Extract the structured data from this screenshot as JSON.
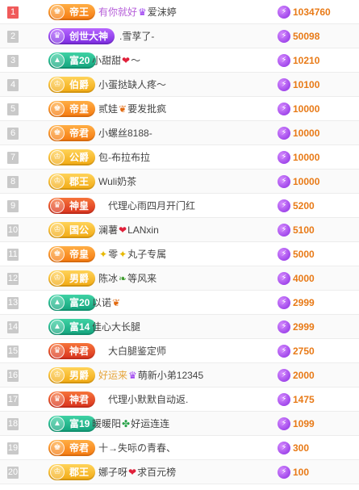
{
  "colors": {
    "score": "#e87a17",
    "rank_top": "#f05a5a",
    "rank_default": "#c9c9c9"
  },
  "rows": [
    {
      "rank": "1",
      "badge": "帝王",
      "badge_color": "orange",
      "name": "有你就好",
      "deco": "crown-icon",
      "name_after": "爱沫婷",
      "name_color": "#b65fd9",
      "score": "1034760"
    },
    {
      "rank": "2",
      "badge": "创世大神",
      "badge_color": "purple",
      "name": ".雪莩了-",
      "deco": "",
      "name_after": "",
      "name_color": "",
      "score": "50098"
    },
    {
      "rank": "3",
      "badge": "富20",
      "badge_color": "green",
      "name": "小甜甜",
      "deco": "heart-icon",
      "name_after": "～",
      "name_color": "",
      "score": "10210"
    },
    {
      "rank": "4",
      "badge": "伯爵",
      "badge_color": "gold",
      "name": "小蛋挞缺人疼～",
      "deco": "",
      "name_after": "",
      "name_color": "",
      "score": "10100"
    },
    {
      "rank": "5",
      "badge": "帝皇",
      "badge_color": "orange",
      "name": "贰娃",
      "deco": "butterfly-icon",
      "name_after": "要发批疯",
      "name_color": "",
      "score": "10000"
    },
    {
      "rank": "6",
      "badge": "帝君",
      "badge_color": "orange",
      "name": "小螺丝8188-",
      "deco": "",
      "name_after": "",
      "name_color": "",
      "score": "10000"
    },
    {
      "rank": "7",
      "badge": "公爵",
      "badge_color": "gold",
      "name": "包-布拉布拉",
      "deco": "",
      "name_after": "",
      "name_color": "",
      "score": "10000"
    },
    {
      "rank": "8",
      "badge": "郡王",
      "badge_color": "gold",
      "name": "Wuli奶茶",
      "deco": "",
      "name_after": "",
      "name_color": "",
      "score": "10000"
    },
    {
      "rank": "9",
      "badge": "神皇",
      "badge_color": "red",
      "name": "代理心雨四月开门红",
      "deco": "",
      "name_after": "",
      "name_color": "",
      "score": "5200"
    },
    {
      "rank": "10",
      "badge": "国公",
      "badge_color": "gold",
      "name": "澜薯",
      "deco": "heart-icon",
      "name_after": "LANxin",
      "name_color": "",
      "score": "5100"
    },
    {
      "rank": "11",
      "badge": "帝皇",
      "badge_color": "orange",
      "name": "",
      "deco": "sparkle-icon",
      "name_after": "零",
      "deco2": "sparkle-icon",
      "name_after2": "丸子专属",
      "name_color": "",
      "score": "5000"
    },
    {
      "rank": "12",
      "badge": "男爵",
      "badge_color": "gold",
      "name": "陈冰",
      "deco": "leaf-icon",
      "name_after": "等风来",
      "name_color": "",
      "score": "4000"
    },
    {
      "rank": "13",
      "badge": "富20",
      "badge_color": "green",
      "name": "以诺",
      "deco": "butterfly-icon",
      "name_after": "",
      "name_color": "",
      "score": "2999"
    },
    {
      "rank": "14",
      "badge": "富14",
      "badge_color": "green",
      "name": "佳心大长腿",
      "deco": "",
      "name_after": "",
      "name_color": "",
      "score": "2999"
    },
    {
      "rank": "15",
      "badge": "神君",
      "badge_color": "red",
      "name": "大白腿鉴定师",
      "deco": "",
      "name_after": "",
      "name_color": "",
      "score": "2750"
    },
    {
      "rank": "16",
      "badge": "男爵",
      "badge_color": "gold",
      "name": "好运来",
      "deco": "crown-icon",
      "name_after": "萌新小弟12345",
      "name_color": "#e6a43a",
      "score": "2000"
    },
    {
      "rank": "17",
      "badge": "神君",
      "badge_color": "red",
      "name": "代理小默默自动返.",
      "deco": "",
      "name_after": "",
      "name_color": "",
      "score": "1475"
    },
    {
      "rank": "18",
      "badge": "富19",
      "badge_color": "green",
      "name": "暖暖阳",
      "deco": "clover-icon",
      "name_after": "好运连连",
      "name_color": "",
      "score": "1099"
    },
    {
      "rank": "19",
      "badge": "帝君",
      "badge_color": "orange",
      "name": "十→失呩の青春、",
      "deco": "",
      "name_after": "",
      "name_color": "",
      "score": "300"
    },
    {
      "rank": "20",
      "badge": "郡王",
      "badge_color": "gold",
      "name": "娜子呀",
      "deco": "heart-icon",
      "name_after": "求百元榜",
      "name_color": "",
      "score": "100"
    }
  ]
}
